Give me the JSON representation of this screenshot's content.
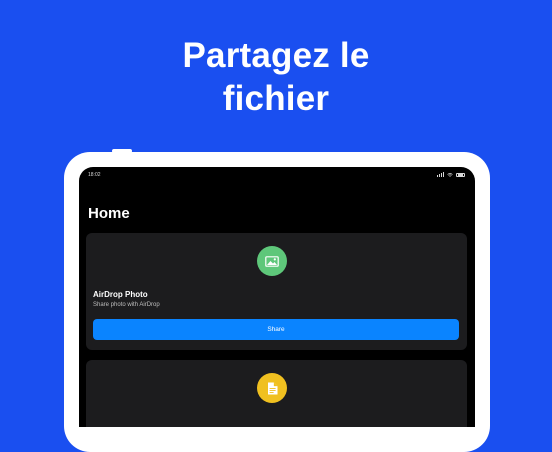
{
  "headline": {
    "line1": "Partagez le",
    "line2": "fichier"
  },
  "status_bar": {
    "time": "18:02",
    "icons": [
      "cellular-signal-icon",
      "wifi-icon",
      "battery-icon"
    ]
  },
  "page": {
    "title": "Home"
  },
  "cards": [
    {
      "icon": "photo-icon",
      "icon_color": "#5ec77a",
      "title": "AirDrop Photo",
      "subtitle": "Share photo with AirDrop",
      "button_label": "Share",
      "button_color": "#0a84ff"
    },
    {
      "icon": "document-icon",
      "icon_color": "#f0c020"
    }
  ],
  "colors": {
    "background": "#1a4ff0",
    "device_frame": "#ffffff",
    "screen": "#000000",
    "card": "#1c1c1e"
  }
}
